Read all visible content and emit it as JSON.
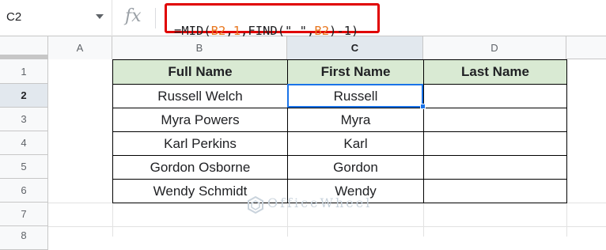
{
  "name_box": {
    "value": "C2"
  },
  "formula": {
    "parts": [
      {
        "text": "=MID(",
        "color": "#202124"
      },
      {
        "text": "B2",
        "color": "#e8761e"
      },
      {
        "text": ",",
        "color": "#202124"
      },
      {
        "text": "1",
        "color": "#e8761e"
      },
      {
        "text": ",FIND(\" \",",
        "color": "#202124"
      },
      {
        "text": "B2",
        "color": "#e8761e"
      },
      {
        "text": ")-1)",
        "color": "#202124"
      }
    ]
  },
  "columns": [
    "A",
    "B",
    "C",
    "D"
  ],
  "rows": [
    "1",
    "2",
    "3",
    "4",
    "5",
    "6",
    "7",
    "8"
  ],
  "selected_cell": "C2",
  "table": {
    "headers": [
      "Full Name",
      "First Name",
      "Last Name"
    ],
    "rows": [
      [
        "Russell Welch",
        "Russell",
        ""
      ],
      [
        "Myra Powers",
        "Myra",
        ""
      ],
      [
        "Karl Perkins",
        "Karl",
        ""
      ],
      [
        "Gordon Osborne",
        "Gordon",
        ""
      ],
      [
        "Wendy Schmidt",
        "Wendy",
        ""
      ]
    ]
  },
  "watermark": "OfficeWheel",
  "colors": {
    "header_fill": "#d9ead3",
    "selection": "#1a73e8",
    "formula_highlight": "#e00000"
  }
}
